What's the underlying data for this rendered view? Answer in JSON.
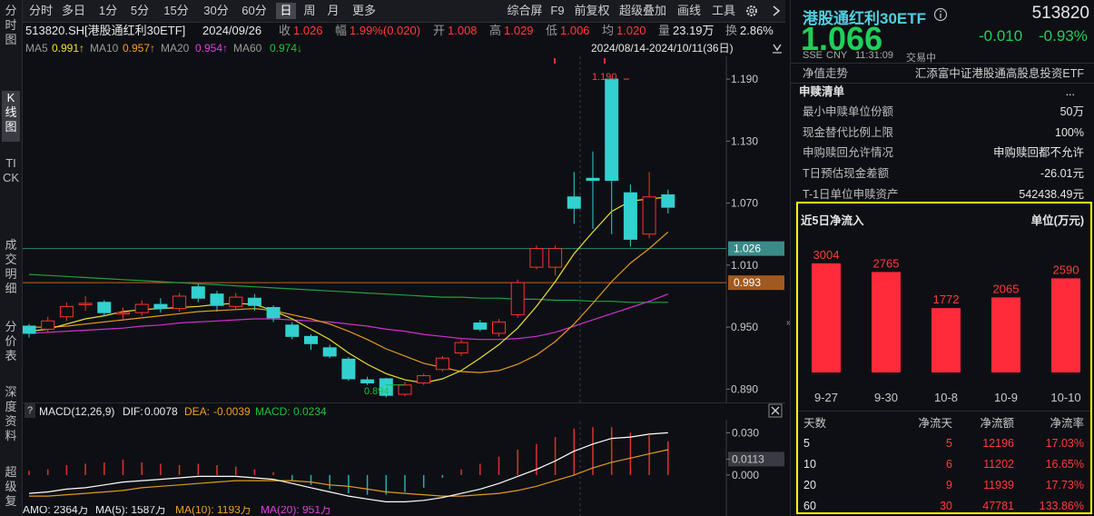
{
  "left_nav": [
    {
      "label": "分时图",
      "active": false
    },
    {
      "label": "K线图",
      "active": true
    },
    {
      "label": "TICK",
      "active": false
    },
    {
      "label": "成交明细",
      "active": false
    },
    {
      "label": "分价表",
      "active": false
    },
    {
      "label": "深度资料",
      "active": false
    },
    {
      "label": "超级复",
      "active": false
    }
  ],
  "toolbar": {
    "periods": [
      "分时",
      "多日",
      "1分",
      "5分",
      "15分",
      "30分",
      "60分",
      "日",
      "周",
      "月",
      "更多"
    ],
    "active_period": "日",
    "actions": [
      "综合屏",
      "F9",
      "前复权",
      "超级叠加",
      "画线",
      "工具"
    ],
    "settings_icon": "gear-icon",
    "nav_arrows": [
      "left-arrow-icon",
      "right-arrow-icon"
    ]
  },
  "info_bar": {
    "code_name": "513820.SH[港股通红利30ETF]",
    "date": "2024/09/26",
    "close_label": "收",
    "close": "1.026",
    "change_label": "幅",
    "change": "1.99%(0.020)",
    "open_label": "开",
    "open": "1.008",
    "high_label": "高",
    "high": "1.029",
    "low_label": "低",
    "low": "1.006",
    "high2_label": "均",
    "high2": "1.020",
    "volume_label": "量",
    "volume": "23.19万",
    "turnover_label": "换",
    "turnover": "2.86%",
    "date_range": "2024/08/14-2024/10/11(36日)"
  },
  "ma_bar": {
    "items": [
      {
        "label": "MA5",
        "value": "0.991↑",
        "color": "#f0e030"
      },
      {
        "label": "MA10",
        "value": "0.957↑",
        "color": "#f0a020"
      },
      {
        "label": "MA20",
        "value": "0.954↑",
        "color": "#e040e0"
      },
      {
        "label": "MA60",
        "value": "0.974↓",
        "color": "#20c040"
      }
    ]
  },
  "price_axis": [
    "1.190",
    "1.130",
    "1.070",
    "1.010",
    "0.950",
    "0.890"
  ],
  "price_tags": [
    {
      "value": "1.026",
      "color": "#3a8a8a"
    },
    {
      "value": "0.993",
      "color": "#a05a20"
    }
  ],
  "annotations": {
    "high": "1.190",
    "low": "0.894"
  },
  "macd_bar": {
    "title": "MACD(12,26,9)",
    "dif_label": "DIF:",
    "dif": "0.0078",
    "dea_label": "DEA:",
    "dea": "-0.0039",
    "macd_label": "MACD:",
    "macd": "0.0234"
  },
  "macd_axis": [
    "0.030",
    "0.0113",
    "0.000"
  ],
  "amo_bar": {
    "amo": "AMO: 2364万",
    "ma5": "MA(5): 1587万",
    "ma10": "MA(10): 1193万",
    "ma20": "MA(20): 951万"
  },
  "quote": {
    "name": "港股通红利30ETF",
    "code": "513820",
    "price": "1.066",
    "change": "-0.010",
    "change_pct": "-0.93%",
    "exchange": "SSE",
    "currency": "CNY",
    "time": "11:31:09",
    "status": "交易中"
  },
  "nav_row": {
    "label": "净值走势",
    "fund": "汇添富中证港股通高股息投资ETF"
  },
  "subscribe": {
    "title": "申赎清单",
    "more": "...",
    "rows": [
      {
        "k": "最小申赎单位份额",
        "v": "50万"
      },
      {
        "k": "现金替代比例上限",
        "v": "100%"
      },
      {
        "k": "申购赎回允许情况",
        "v": "申购赎回都不允许"
      },
      {
        "k": "T日预估现金差额",
        "v": "-26.01元"
      },
      {
        "k": "T-1日单位申赎资产",
        "v": "542438.49元"
      }
    ]
  },
  "net_inflow": {
    "title": "近5日净流入",
    "unit": "单位(万元)",
    "bars": [
      {
        "date": "9-27",
        "value": 3004
      },
      {
        "date": "9-30",
        "value": 2765
      },
      {
        "date": "10-8",
        "value": 1772
      },
      {
        "date": "10-9",
        "value": 2065
      },
      {
        "date": "10-10",
        "value": 2590
      }
    ],
    "table_headers": [
      "天数",
      "净流天",
      "净流额",
      "净流率"
    ],
    "table_rows": [
      [
        "5",
        "5",
        "12196",
        "17.03%"
      ],
      [
        "10",
        "6",
        "11202",
        "16.65%"
      ],
      [
        "20",
        "9",
        "11939",
        "17.73%"
      ],
      [
        "60",
        "30",
        "47781",
        "133.86%"
      ]
    ]
  },
  "chart_data": {
    "type": "candlestick",
    "ylim": [
      0.878,
      1.205
    ],
    "candles": [
      {
        "o": 0.951,
        "c": 0.944,
        "h": 0.953,
        "l": 0.94
      },
      {
        "o": 0.948,
        "c": 0.956,
        "h": 0.96,
        "l": 0.945
      },
      {
        "o": 0.96,
        "c": 0.97,
        "h": 0.974,
        "l": 0.956
      },
      {
        "o": 0.972,
        "c": 0.973,
        "h": 0.98,
        "l": 0.966
      },
      {
        "o": 0.974,
        "c": 0.964,
        "h": 0.976,
        "l": 0.961
      },
      {
        "o": 0.963,
        "c": 0.964,
        "h": 0.969,
        "l": 0.957
      },
      {
        "o": 0.964,
        "c": 0.972,
        "h": 0.976,
        "l": 0.961
      },
      {
        "o": 0.972,
        "c": 0.968,
        "h": 0.978,
        "l": 0.964
      },
      {
        "o": 0.968,
        "c": 0.98,
        "h": 0.983,
        "l": 0.965
      },
      {
        "o": 0.989,
        "c": 0.978,
        "h": 0.992,
        "l": 0.974
      },
      {
        "o": 0.982,
        "c": 0.971,
        "h": 0.985,
        "l": 0.965
      },
      {
        "o": 0.97,
        "c": 0.979,
        "h": 0.983,
        "l": 0.967
      },
      {
        "o": 0.978,
        "c": 0.971,
        "h": 0.982,
        "l": 0.966
      },
      {
        "o": 0.969,
        "c": 0.959,
        "h": 0.971,
        "l": 0.955
      },
      {
        "o": 0.952,
        "c": 0.941,
        "h": 0.955,
        "l": 0.938
      },
      {
        "o": 0.941,
        "c": 0.934,
        "h": 0.943,
        "l": 0.928
      },
      {
        "o": 0.93,
        "c": 0.922,
        "h": 0.933,
        "l": 0.92
      },
      {
        "o": 0.919,
        "c": 0.9,
        "h": 0.921,
        "l": 0.898
      },
      {
        "o": 0.899,
        "c": 0.896,
        "h": 0.902,
        "l": 0.894
      },
      {
        "o": 0.9,
        "c": 0.884,
        "h": 0.901,
        "l": 0.882
      },
      {
        "o": 0.885,
        "c": 0.894,
        "h": 0.897,
        "l": 0.883
      },
      {
        "o": 0.896,
        "c": 0.903,
        "h": 0.905,
        "l": 0.894
      },
      {
        "o": 0.909,
        "c": 0.92,
        "h": 0.922,
        "l": 0.907
      },
      {
        "o": 0.925,
        "c": 0.935,
        "h": 0.938,
        "l": 0.922
      },
      {
        "o": 0.954,
        "c": 0.948,
        "h": 0.957,
        "l": 0.946
      },
      {
        "o": 0.944,
        "c": 0.955,
        "h": 0.958,
        "l": 0.941
      },
      {
        "o": 0.962,
        "c": 0.993,
        "h": 0.996,
        "l": 0.959
      },
      {
        "o": 1.008,
        "c": 1.026,
        "h": 1.029,
        "l": 1.006
      },
      {
        "o": 1.008,
        "c": 1.026,
        "h": 1.029,
        "l": 1.0
      },
      {
        "o": 1.076,
        "c": 1.065,
        "h": 1.1,
        "l": 1.05
      },
      {
        "o": 1.094,
        "c": 1.092,
        "h": 1.12,
        "l": 1.045
      },
      {
        "o": 1.19,
        "c": 1.092,
        "h": 1.19,
        "l": 1.04
      },
      {
        "o": 1.08,
        "c": 1.035,
        "h": 1.088,
        "l": 1.028
      },
      {
        "o": 1.04,
        "c": 1.076,
        "h": 1.1,
        "l": 1.036
      },
      {
        "o": 1.078,
        "c": 1.066,
        "h": 1.083,
        "l": 1.06
      }
    ],
    "ma5": [
      0.946,
      0.948,
      0.953,
      0.958,
      0.961,
      0.965,
      0.967,
      0.968,
      0.969,
      0.97,
      0.972,
      0.973,
      0.972,
      0.966,
      0.958,
      0.948,
      0.938,
      0.925,
      0.914,
      0.905,
      0.899,
      0.896,
      0.9,
      0.908,
      0.92,
      0.933,
      0.949,
      0.97,
      0.994,
      1.021,
      1.042,
      1.062,
      1.072,
      1.074,
      1.076
    ],
    "ma10": [
      0.95,
      0.95,
      0.951,
      0.953,
      0.955,
      0.957,
      0.959,
      0.961,
      0.963,
      0.965,
      0.966,
      0.967,
      0.968,
      0.966,
      0.962,
      0.958,
      0.953,
      0.946,
      0.938,
      0.929,
      0.922,
      0.915,
      0.911,
      0.907,
      0.906,
      0.908,
      0.914,
      0.923,
      0.936,
      0.953,
      0.973,
      0.994,
      1.012,
      1.026,
      1.042
    ],
    "ma20": [
      0.944,
      0.945,
      0.946,
      0.947,
      0.948,
      0.949,
      0.951,
      0.952,
      0.954,
      0.955,
      0.956,
      0.957,
      0.958,
      0.958,
      0.957,
      0.956,
      0.955,
      0.953,
      0.951,
      0.948,
      0.946,
      0.943,
      0.941,
      0.939,
      0.938,
      0.938,
      0.939,
      0.941,
      0.945,
      0.951,
      0.957,
      0.963,
      0.969,
      0.975,
      0.982
    ],
    "ma60": [
      1.001,
      1.0,
      0.999,
      0.998,
      0.997,
      0.996,
      0.995,
      0.994,
      0.993,
      0.992,
      0.991,
      0.99,
      0.989,
      0.988,
      0.987,
      0.986,
      0.985,
      0.984,
      0.983,
      0.982,
      0.981,
      0.98,
      0.979,
      0.979,
      0.978,
      0.978,
      0.977,
      0.977,
      0.976,
      0.976,
      0.975,
      0.975,
      0.974,
      0.974,
      0.974
    ],
    "hlines": [
      {
        "value": 1.026,
        "color": "#2a8a6a"
      },
      {
        "value": 0.993,
        "color": "#c06020"
      }
    ],
    "macd": {
      "ylim": [
        -0.022,
        0.038
      ],
      "dif": [
        -0.013,
        -0.012,
        -0.01,
        -0.009,
        -0.007,
        -0.005,
        -0.004,
        -0.003,
        -0.002,
        -0.001,
        -0.001,
        -0.001,
        -0.002,
        -0.003,
        -0.006,
        -0.009,
        -0.012,
        -0.015,
        -0.017,
        -0.019,
        -0.019,
        -0.018,
        -0.016,
        -0.013,
        -0.01,
        -0.006,
        -0.001,
        0.004,
        0.01,
        0.017,
        0.022,
        0.026,
        0.027,
        0.029,
        0.03
      ],
      "dea": [
        -0.015,
        -0.015,
        -0.014,
        -0.013,
        -0.012,
        -0.011,
        -0.009,
        -0.008,
        -0.007,
        -0.006,
        -0.005,
        -0.004,
        -0.004,
        -0.004,
        -0.004,
        -0.005,
        -0.007,
        -0.008,
        -0.01,
        -0.012,
        -0.013,
        -0.014,
        -0.015,
        -0.015,
        -0.014,
        -0.013,
        -0.011,
        -0.008,
        -0.004,
        0.0,
        0.005,
        0.009,
        0.012,
        0.015,
        0.018
      ],
      "hist": [
        0.003,
        0.004,
        0.007,
        0.008,
        0.009,
        0.011,
        0.009,
        0.008,
        0.007,
        0.008,
        0.007,
        0.006,
        0.004,
        0.002,
        -0.004,
        -0.007,
        -0.01,
        -0.013,
        -0.014,
        -0.014,
        -0.012,
        -0.009,
        -0.002,
        0.004,
        0.008,
        0.013,
        0.018,
        0.022,
        0.027,
        0.033,
        0.034,
        0.034,
        0.03,
        0.028,
        0.024
      ]
    }
  }
}
